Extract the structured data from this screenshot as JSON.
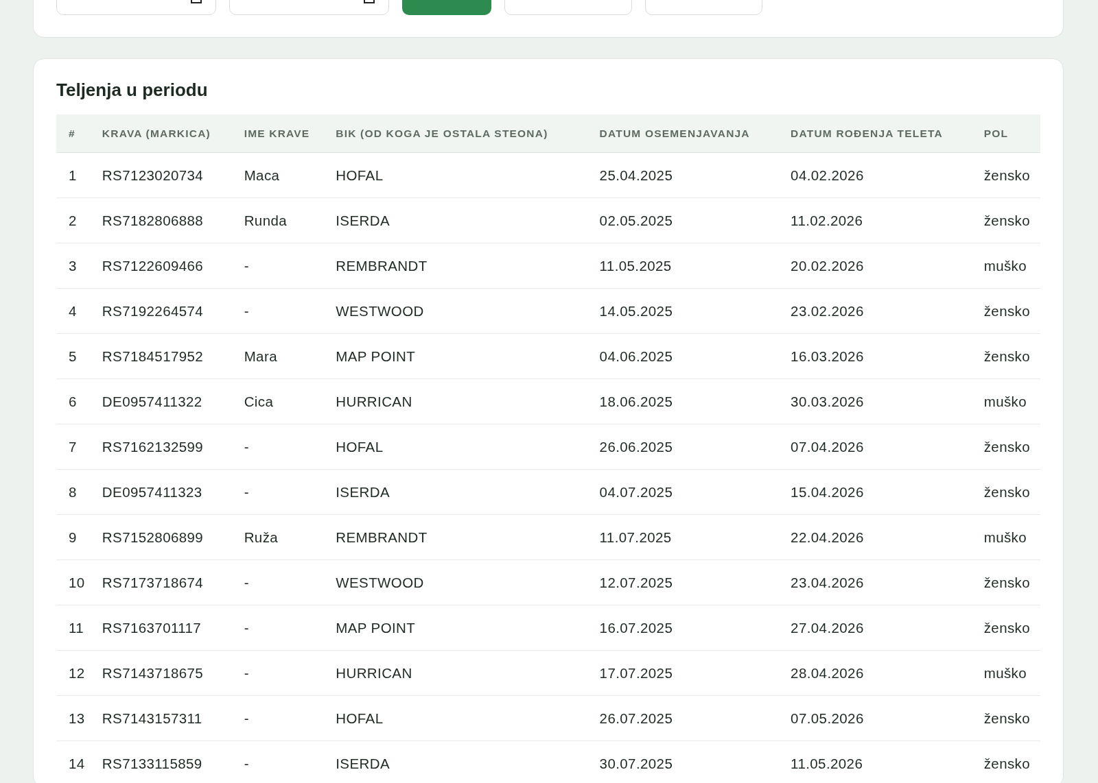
{
  "filters": [
    {
      "kind": "date"
    },
    {
      "kind": "date"
    },
    {
      "kind": "button"
    },
    {
      "kind": "select"
    },
    {
      "kind": "select"
    }
  ],
  "section": {
    "title": "Teljenja u periodu"
  },
  "table": {
    "columns": [
      "#",
      "KRAVA (MARKICA)",
      "IME KRAVE",
      "BIK (OD KOGA JE OSTALA STEONA)",
      "DATUM OSEMENJAVANJA",
      "DATUM ROĐENJA TELETA",
      "POL"
    ],
    "rows": [
      [
        "1",
        "RS7123020734",
        "Maca",
        "HOFAL",
        "25.04.2025",
        "04.02.2026",
        "žensko"
      ],
      [
        "2",
        "RS7182806888",
        "Runda",
        "ISERDA",
        "02.05.2025",
        "11.02.2026",
        "žensko"
      ],
      [
        "3",
        "RS7122609466",
        "-",
        "REMBRANDT",
        "11.05.2025",
        "20.02.2026",
        "muško"
      ],
      [
        "4",
        "RS7192264574",
        "-",
        "WESTWOOD",
        "14.05.2025",
        "23.02.2026",
        "žensko"
      ],
      [
        "5",
        "RS7184517952",
        "Mara",
        "MAP POINT",
        "04.06.2025",
        "16.03.2026",
        "žensko"
      ],
      [
        "6",
        "DE0957411322",
        "Cica",
        "HURRICAN",
        "18.06.2025",
        "30.03.2026",
        "muško"
      ],
      [
        "7",
        "RS7162132599",
        "-",
        "HOFAL",
        "26.06.2025",
        "07.04.2026",
        "žensko"
      ],
      [
        "8",
        "DE0957411323",
        "-",
        "ISERDA",
        "04.07.2025",
        "15.04.2026",
        "žensko"
      ],
      [
        "9",
        "RS7152806899",
        "Ruža",
        "REMBRANDT",
        "11.07.2025",
        "22.04.2026",
        "muško"
      ],
      [
        "10",
        "RS7173718674",
        "-",
        "WESTWOOD",
        "12.07.2025",
        "23.04.2026",
        "žensko"
      ],
      [
        "11",
        "RS7163701117",
        "-",
        "MAP POINT",
        "16.07.2025",
        "27.04.2026",
        "žensko"
      ],
      [
        "12",
        "RS7143718675",
        "-",
        "HURRICAN",
        "17.07.2025",
        "28.04.2026",
        "muško"
      ],
      [
        "13",
        "RS7143157311",
        "-",
        "HOFAL",
        "26.07.2025",
        "07.05.2026",
        "žensko"
      ],
      [
        "14",
        "RS7133115859",
        "-",
        "ISERDA",
        "30.07.2025",
        "11.05.2026",
        "žensko"
      ]
    ]
  }
}
